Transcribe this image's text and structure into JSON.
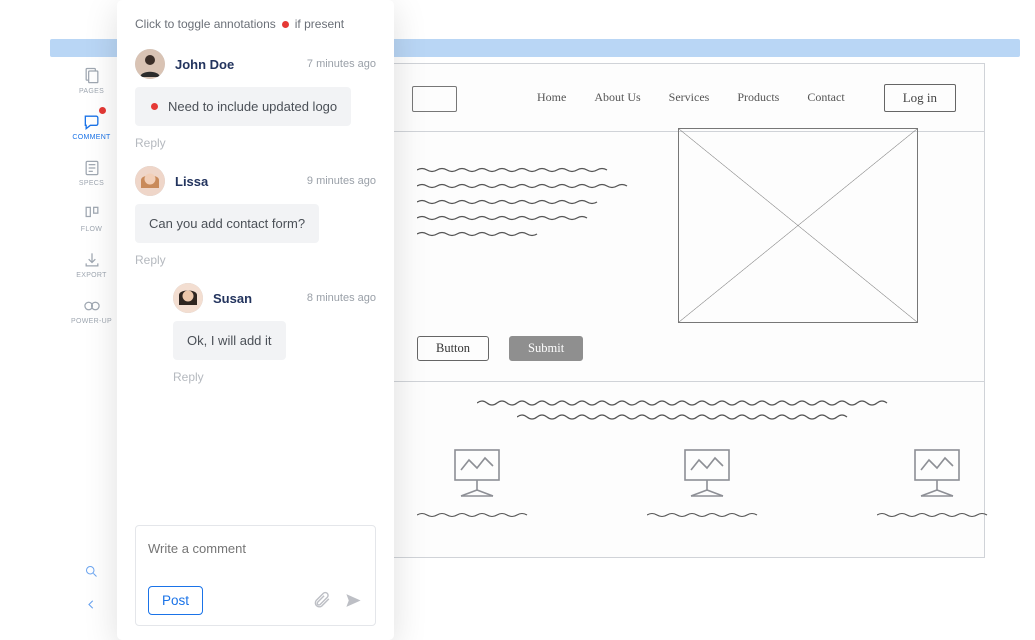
{
  "toggle": {
    "pre": "Click to toggle annotations",
    "post": "if present"
  },
  "rail": {
    "pages": "PAGES",
    "comment": "COMMENT",
    "specs": "SPECS",
    "flow": "FLOW",
    "export": "EXPORT",
    "powerup": "POWER-UP"
  },
  "comments": [
    {
      "author": "John Doe",
      "time": "7 minutes ago",
      "text": "Need to include updated logo",
      "has_dot": true
    },
    {
      "author": "Lissa",
      "time": "9 minutes ago",
      "text": "Can you add contact form?"
    },
    {
      "author": "Susan",
      "time": "8 minutes ago",
      "text": "Ok, I will add it",
      "indent": true
    }
  ],
  "reply_label": "Reply",
  "composer": {
    "placeholder": "Write a comment",
    "post": "Post"
  },
  "wireframe": {
    "nav": [
      "Home",
      "About Us",
      "Services",
      "Products",
      "Contact"
    ],
    "login": "Log in",
    "btn1": "Button",
    "btn2": "Submit"
  }
}
